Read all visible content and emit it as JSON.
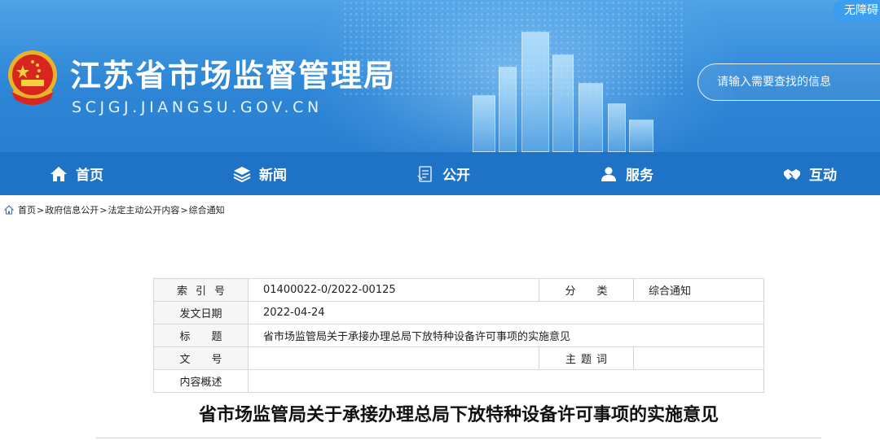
{
  "header": {
    "site_title": "江苏省市场监督管理局",
    "site_domain": "SCJGJ.JIANGSU.GOV.CN",
    "accessibility_label": "无障碍",
    "search_placeholder": "请输入需要查找的信息",
    "colors": {
      "banner": "#2e86d6",
      "nav": "#1f73c6",
      "accent": "#3b9ef0"
    }
  },
  "nav": {
    "items": [
      {
        "label": "首页",
        "icon": "home-icon"
      },
      {
        "label": "新闻",
        "icon": "layers-icon"
      },
      {
        "label": "公开",
        "icon": "document-icon"
      },
      {
        "label": "服务",
        "icon": "user-icon"
      },
      {
        "label": "互动",
        "icon": "handshake-icon"
      }
    ]
  },
  "breadcrumb": {
    "items": [
      "首页",
      "政府信息公开",
      "法定主动公开内容",
      "综合通知"
    ],
    "separator": ">"
  },
  "meta": {
    "index_label": "索引号",
    "index_value": "01400022-0/2022-00125",
    "category_label": "分类",
    "category_value": "综合通知",
    "date_label": "发文日期",
    "date_value": "2022-04-24",
    "title_label": "标题",
    "title_value": "省市场监管局关于承接办理总局下放特种设备许可事项的实施意见",
    "doc_no_label": "文号",
    "doc_no_value": "",
    "keyword_label": "主题词",
    "keyword_value": "",
    "summary_label": "内容概述",
    "summary_value": ""
  },
  "article": {
    "title": "省市场监管局关于承接办理总局下放特种设备许可事项的实施意见"
  }
}
